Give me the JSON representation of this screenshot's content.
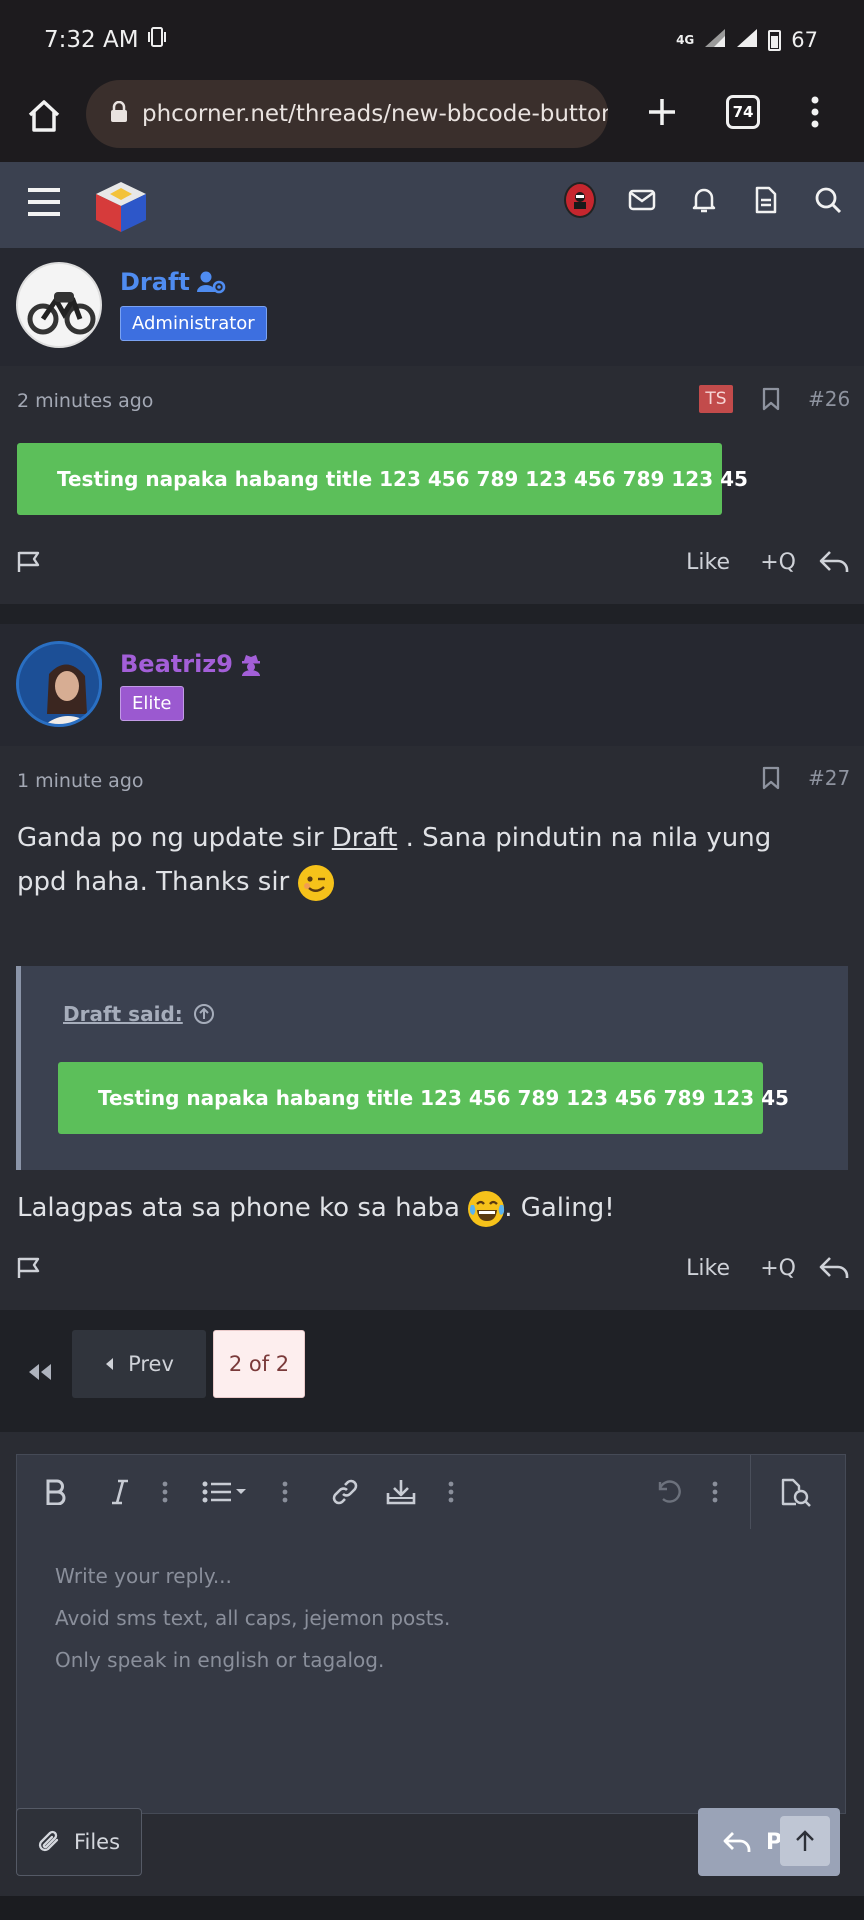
{
  "status_bar": {
    "time": "7:32 AM",
    "network": "4G",
    "battery": "67"
  },
  "browser": {
    "url_host": "phcorner.net",
    "url_path": "/threads/new-bbcode-button",
    "tab_count": "74"
  },
  "post1": {
    "username": "Draft",
    "role": "Administrator",
    "time": "2 minutes ago",
    "ts_badge": "TS",
    "number": "#26",
    "download_label": "Testing napaka habang title 123 456 789 123 456 789 123 45",
    "like_label": "Like",
    "quote_label": "+Q"
  },
  "post2": {
    "username": "Beatriz9",
    "role": "Elite",
    "time": "1 minute ago",
    "number": "#27",
    "text_before_mention": "Ganda po ng update sir ",
    "mention": "Draft",
    "text_after_mention": " . Sana pindutin na nila yung ppd haha. Thanks sir ",
    "quote_author": "Draft said:",
    "quote_download_label": "Testing napaka habang title 123 456 789 123 456 789 123 45",
    "text2_before_emoji": "Lalagpas ata sa phone ko sa haba ",
    "text2_after_emoji": ". Galing!",
    "like_label": "Like",
    "quote_label": "+Q"
  },
  "pagination": {
    "prev_label": "Prev",
    "page_indicator": "2 of 2"
  },
  "editor": {
    "placeholder_lines": [
      "Write your reply...",
      "Avoid sms text, all caps, jejemon posts.",
      "Only speak in english or tagalog."
    ],
    "files_label": "Files",
    "post_label": "Post"
  },
  "colors": {
    "header_bg": "#3b4150",
    "download_green": "#5cbf5a",
    "admin_badge": "#3d6fe0",
    "elite_badge": "#9b59d0",
    "admin_name": "#4f8cf0",
    "elite_name": "#a35fd8"
  }
}
